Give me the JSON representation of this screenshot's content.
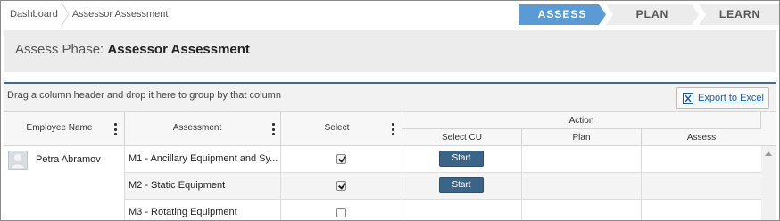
{
  "breadcrumb": {
    "items": [
      "Dashboard",
      "Assessor Assessment"
    ]
  },
  "phases": [
    {
      "label": "ASSESS",
      "active": true
    },
    {
      "label": "PLAN",
      "active": false
    },
    {
      "label": "LEARN",
      "active": false
    }
  ],
  "page": {
    "title_prefix": "Assess Phase:",
    "title_main": "Assessor Assessment"
  },
  "grid": {
    "group_hint": "Drag a column header and drop it here to group by that column",
    "export_label": "Export to Excel",
    "columns": {
      "employee_name": "Employee Name",
      "assessment": "Assessment",
      "select": "Select",
      "action": "Action",
      "select_cu": "Select CU",
      "plan": "Plan",
      "assess": "Assess"
    },
    "employee": {
      "name": "Petra Abramov"
    },
    "rows": [
      {
        "assessment": "M1 - Ancillary Equipment and Sy...",
        "selected": true,
        "action_label": "Start"
      },
      {
        "assessment": "M2 - Static Equipment",
        "selected": true,
        "action_label": "Start"
      },
      {
        "assessment": "M3 - Rotating Equipment",
        "selected": false,
        "action_label": ""
      }
    ]
  },
  "colors": {
    "active_phase": "#5b9bd5",
    "inactive_phase": "#ececec",
    "start_button": "#3c6486",
    "divider": "#3a6c95"
  }
}
